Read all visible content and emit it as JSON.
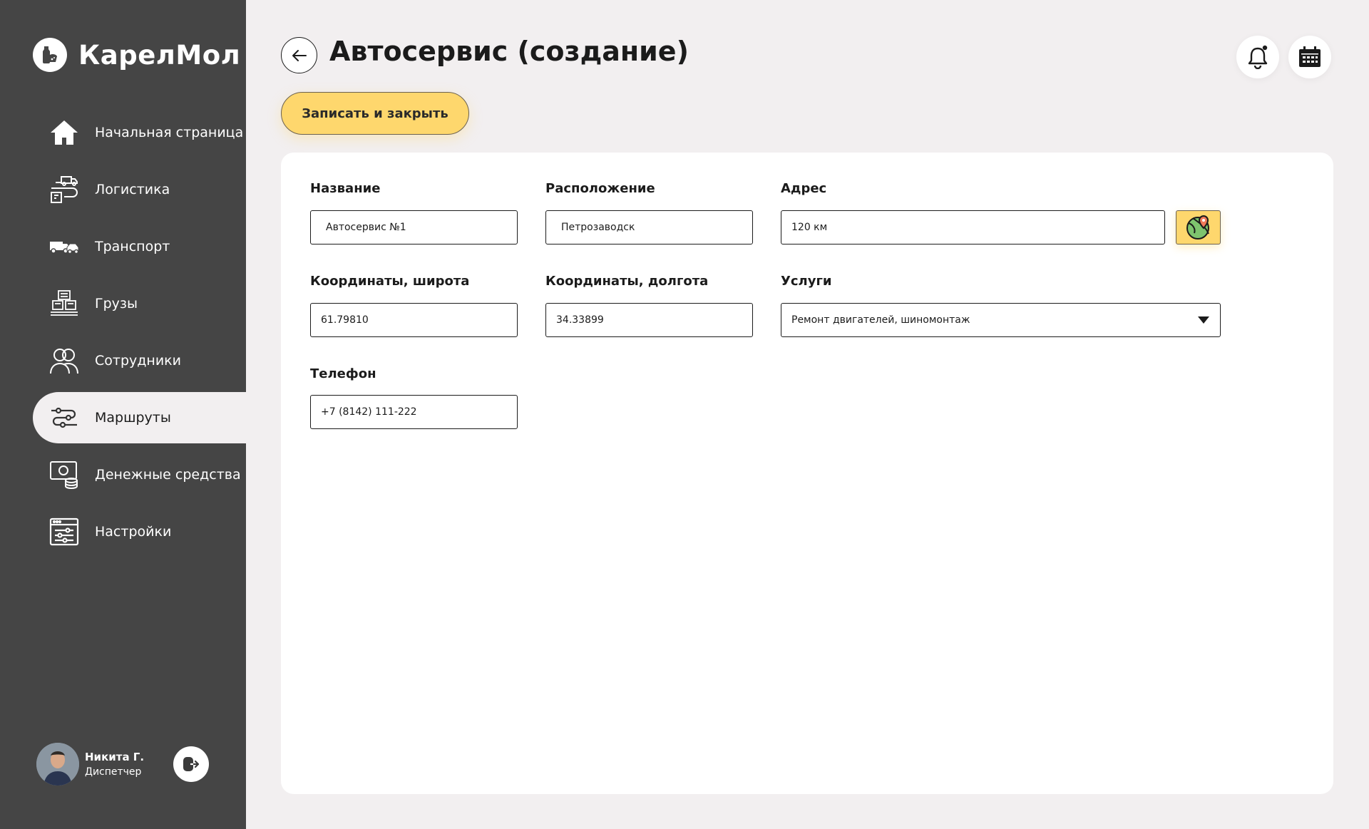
{
  "app": {
    "logo_text": "КарелМол",
    "logo_icon": "milk-bottle-cheese-icon"
  },
  "sidebar": {
    "items": [
      {
        "label": "Начальная страница",
        "icon": "home-icon"
      },
      {
        "label": "Логистика",
        "icon": "logistics-icon"
      },
      {
        "label": "Транспорт",
        "icon": "transport-icon"
      },
      {
        "label": "Грузы",
        "icon": "cargo-icon"
      },
      {
        "label": "Сотрудники",
        "icon": "employees-icon"
      },
      {
        "label": "Маршруты",
        "icon": "routes-icon",
        "active": true
      },
      {
        "label": "Денежные средства",
        "icon": "money-icon"
      },
      {
        "label": "Настройки",
        "icon": "settings-icon"
      }
    ],
    "user": {
      "name": "Никита Г.",
      "role": "Диспетчер"
    }
  },
  "header": {
    "title": "Автосервис (создание)",
    "save_label": "Записать и закрыть"
  },
  "form": {
    "name": {
      "label": "Название",
      "value": "Автосервис №1"
    },
    "location": {
      "label": "Расположение",
      "value": "Петрозаводск"
    },
    "address": {
      "label": "Адрес",
      "value": "120 км"
    },
    "latitude": {
      "label": "Координаты, широта",
      "value": "61.79810"
    },
    "longitude": {
      "label": "Координаты, долгота",
      "value": "34.33899"
    },
    "services": {
      "label": "Услуги",
      "value": "Ремонт двигателей, шиномонтаж"
    },
    "phone": {
      "label": "Телефон",
      "value": "+7 (8142) 111-222"
    }
  },
  "colors": {
    "sidebar_bg": "#454545",
    "page_bg": "#f2eff0",
    "accent": "#fed76d"
  }
}
